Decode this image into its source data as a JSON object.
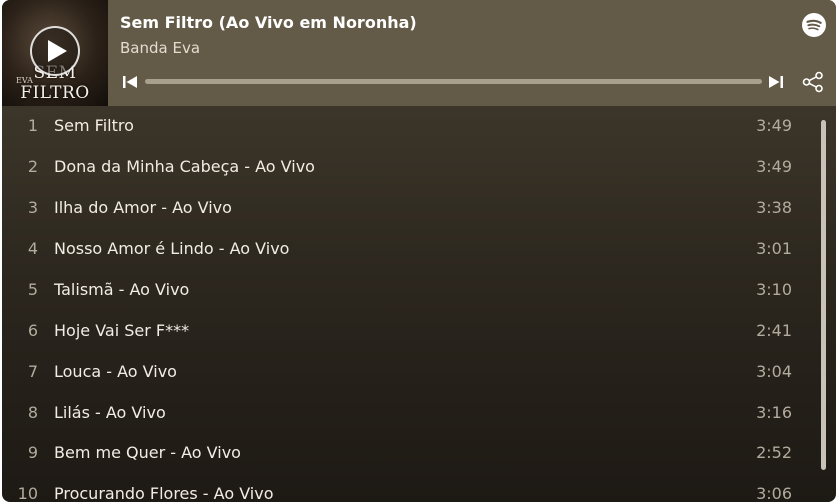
{
  "album": {
    "title": "Sem Filtro (Ao Vivo em Noronha)",
    "artist": "Banda Eva",
    "cover_text": "SEM FILTRO",
    "cover_small_text": "EVA"
  },
  "player": {
    "progress_fraction": 0.0,
    "accent_color": "#ffffff",
    "header_color": "#645a48"
  },
  "icons": {
    "play": "play-icon",
    "previous": "skip-previous-icon",
    "next": "skip-next-icon",
    "share": "share-icon",
    "brand": "spotify-icon"
  },
  "tracks": [
    {
      "number": "1",
      "title": "Sem Filtro",
      "duration": "3:49"
    },
    {
      "number": "2",
      "title": "Dona da Minha Cabeça - Ao Vivo",
      "duration": "3:49"
    },
    {
      "number": "3",
      "title": "Ilha do Amor - Ao Vivo",
      "duration": "3:38"
    },
    {
      "number": "4",
      "title": "Nosso Amor é Lindo - Ao Vivo",
      "duration": "3:01"
    },
    {
      "number": "5",
      "title": "Talismã - Ao Vivo",
      "duration": "3:10"
    },
    {
      "number": "6",
      "title": "Hoje Vai Ser F***",
      "duration": "2:41"
    },
    {
      "number": "7",
      "title": "Louca - Ao Vivo",
      "duration": "3:04"
    },
    {
      "number": "8",
      "title": "Lilás - Ao Vivo",
      "duration": "3:16"
    },
    {
      "number": "9",
      "title": "Bem me Quer - Ao Vivo",
      "duration": "2:52"
    },
    {
      "number": "10",
      "title": "Procurando Flores - Ao Vivo",
      "duration": "3:06"
    }
  ]
}
